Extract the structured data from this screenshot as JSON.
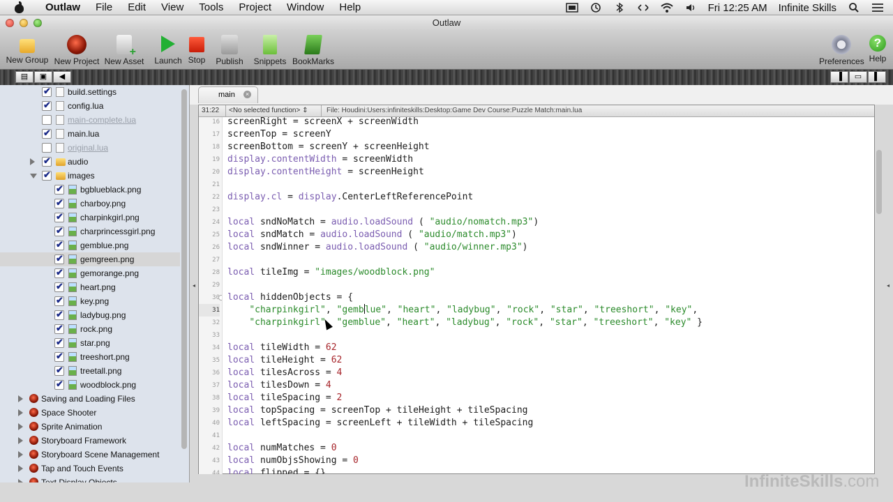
{
  "menubar": {
    "app_name": "Outlaw",
    "items": [
      "File",
      "Edit",
      "View",
      "Tools",
      "Project",
      "Window",
      "Help"
    ],
    "clock": "Fri 12:25 AM",
    "user": "Infinite Skills"
  },
  "window": {
    "title": "Outlaw"
  },
  "toolbar": {
    "new_group": "New Group",
    "new_project": "New Project",
    "new_asset": "New Asset",
    "launch": "Launch",
    "stop": "Stop",
    "publish": "Publish",
    "snippets": "Snippets",
    "bookmarks": "BookMarks",
    "preferences": "Preferences",
    "help": "Help"
  },
  "sidebar": {
    "rows": [
      {
        "label": "build.settings",
        "type": "file",
        "checked": true,
        "dim": false
      },
      {
        "label": "config.lua",
        "type": "file",
        "checked": true,
        "dim": false
      },
      {
        "label": "main-complete.lua",
        "type": "file",
        "checked": false,
        "dim": true
      },
      {
        "label": "main.lua",
        "type": "file",
        "checked": true,
        "dim": false
      },
      {
        "label": "original.lua",
        "type": "file",
        "checked": false,
        "dim": true
      },
      {
        "label": "audio",
        "type": "folder",
        "checked": true,
        "dim": false,
        "expanded": false
      },
      {
        "label": "images",
        "type": "folder",
        "checked": true,
        "dim": false,
        "expanded": true
      },
      {
        "label": "bgblueblack.png",
        "type": "image",
        "checked": true
      },
      {
        "label": "charboy.png",
        "type": "image",
        "checked": true
      },
      {
        "label": "charpinkgirl.png",
        "type": "image",
        "checked": true
      },
      {
        "label": "charprincessgirl.png",
        "type": "image",
        "checked": true
      },
      {
        "label": "gemblue.png",
        "type": "image",
        "checked": true
      },
      {
        "label": "gemgreen.png",
        "type": "image",
        "checked": true,
        "selected": true
      },
      {
        "label": "gemorange.png",
        "type": "image",
        "checked": true
      },
      {
        "label": "heart.png",
        "type": "image",
        "checked": true
      },
      {
        "label": "key.png",
        "type": "image",
        "checked": true
      },
      {
        "label": "ladybug.png",
        "type": "image",
        "checked": true
      },
      {
        "label": "rock.png",
        "type": "image",
        "checked": true
      },
      {
        "label": "star.png",
        "type": "image",
        "checked": true
      },
      {
        "label": "treeshort.png",
        "type": "image",
        "checked": true
      },
      {
        "label": "treetall.png",
        "type": "image",
        "checked": true
      },
      {
        "label": "woodblock.png",
        "type": "image",
        "checked": true
      },
      {
        "label": "Saving and Loading Files",
        "type": "project"
      },
      {
        "label": "Space Shooter",
        "type": "project"
      },
      {
        "label": "Sprite Animation",
        "type": "project"
      },
      {
        "label": "Storyboard Framework",
        "type": "project"
      },
      {
        "label": "Storyboard Scene Management",
        "type": "project"
      },
      {
        "label": "Tap and Touch Events",
        "type": "project"
      },
      {
        "label": "Text Display Objects",
        "type": "project"
      }
    ]
  },
  "editor": {
    "tab_name": "main",
    "cursor_pos": "31:22",
    "function_select": "<No selected function>",
    "file_path": "File: Houdini:Users:infiniteskills:Desktop:Game Dev Course:Puzzle Match:main.lua",
    "current_line": 31,
    "lines": [
      {
        "n": "16",
        "t": "screenRight = screenX + screenWidth"
      },
      {
        "n": "17",
        "t": "screenTop = screenY"
      },
      {
        "n": "18",
        "t": "screenBottom = screenY + screenHeight"
      },
      {
        "n": "19",
        "t": "display.contentWidth = screenWidth"
      },
      {
        "n": "20",
        "t": "display.contentHeight = screenHeight"
      },
      {
        "n": "21",
        "t": ""
      },
      {
        "n": "22",
        "t": "display.cl = display.CenterLeftReferencePoint"
      },
      {
        "n": "23",
        "t": ""
      },
      {
        "n": "24",
        "t": "local sndNoMatch = audio.loadSound ( \"audio/nomatch.mp3\")"
      },
      {
        "n": "25",
        "t": "local sndMatch = audio.loadSound ( \"audio/match.mp3\")"
      },
      {
        "n": "26",
        "t": "local sndWinner = audio.loadSound ( \"audio/winner.mp3\")"
      },
      {
        "n": "27",
        "t": ""
      },
      {
        "n": "28",
        "t": "local tileImg = \"images/woodblock.png\""
      },
      {
        "n": "29",
        "t": ""
      },
      {
        "n": "30",
        "t": "local hiddenObjects = {"
      },
      {
        "n": "31",
        "t": "    \"charpinkgirl\", \"gemblue\", \"heart\", \"ladybug\", \"rock\", \"star\", \"treeshort\", \"key\","
      },
      {
        "n": "32",
        "t": "    \"charpinkgirl\", \"gemblue\", \"heart\", \"ladybug\", \"rock\", \"star\", \"treeshort\", \"key\" }"
      },
      {
        "n": "33",
        "t": ""
      },
      {
        "n": "34",
        "t": "local tileWidth = 62"
      },
      {
        "n": "35",
        "t": "local tileHeight = 62"
      },
      {
        "n": "36",
        "t": "local tilesAcross = 4"
      },
      {
        "n": "37",
        "t": "local tilesDown = 4"
      },
      {
        "n": "38",
        "t": "local tileSpacing = 2"
      },
      {
        "n": "39",
        "t": "local topSpacing = screenTop + tileHeight + tileSpacing"
      },
      {
        "n": "40",
        "t": "local leftSpacing = screenLeft + tileWidth + tileSpacing"
      },
      {
        "n": "41",
        "t": ""
      },
      {
        "n": "42",
        "t": "local numMatches = 0"
      },
      {
        "n": "43",
        "t": "local numObjsShowing = 0"
      },
      {
        "n": "44",
        "t": "local flipped = {}"
      }
    ]
  },
  "watermark": {
    "brand": "InfiniteSkills",
    "domain": ".com"
  },
  "colors": {
    "keyword": "#7a5cb0",
    "string": "#2a8a2a",
    "number": "#a6242a",
    "sidebar_bg": "#dde3ec"
  }
}
